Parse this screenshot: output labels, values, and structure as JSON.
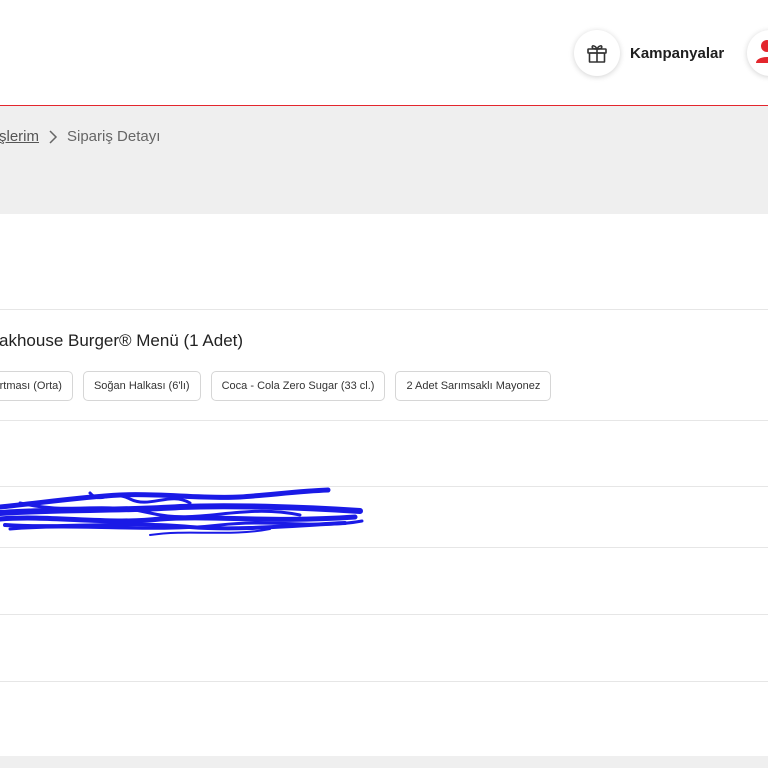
{
  "header": {
    "promo_label": "Kampanyalar",
    "promo_icon": "gift-icon",
    "account_icon": "user-icon",
    "accent_color": "#e3262d"
  },
  "breadcrumb": {
    "parent": "şlerim",
    "separator_icon": "chevron-right-icon",
    "current": "Sipariş Detayı"
  },
  "order": {
    "product_title": "akhouse Burger® Menü (1 Adet)",
    "options": [
      "zartması (Orta)",
      "Soğan Halkası (6'lı)",
      "Coca - Cola Zero Sugar (33 cl.)",
      "2 Adet Sarımsaklı Mayonez"
    ]
  }
}
